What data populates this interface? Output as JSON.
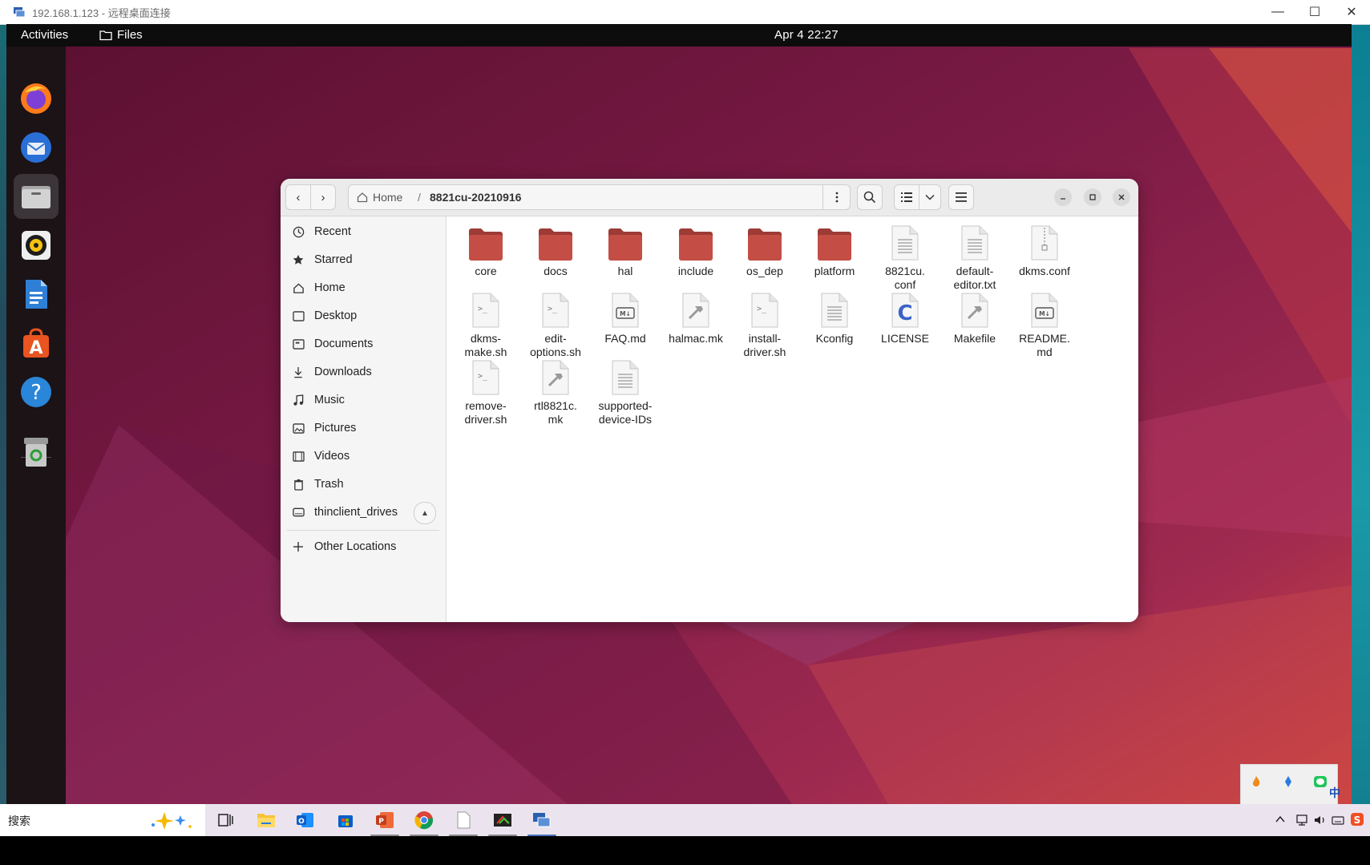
{
  "rdp": {
    "title": "192.168.1.123 - 远程桌面连接",
    "minimize": "—",
    "maximize": "☐",
    "close": "✕"
  },
  "topbar": {
    "activities": "Activities",
    "app_menu": "Files",
    "clock": "Apr 4  22:27"
  },
  "dock": {
    "items": [
      "firefox-icon",
      "thunderbird-icon",
      "files-icon",
      "rhythmbox-icon",
      "libreoffice-writer-icon",
      "app-center-icon",
      "help-icon",
      "trash-icon"
    ]
  },
  "nautilus": {
    "back": "‹",
    "forward": "›",
    "path": {
      "home": "Home",
      "separator": "/",
      "current": "8821cu-20210916"
    },
    "sidebar": [
      {
        "label": "Recent",
        "icon": "clock-icon"
      },
      {
        "label": "Starred",
        "icon": "star-icon"
      },
      {
        "label": "Home",
        "icon": "home-icon"
      },
      {
        "label": "Desktop",
        "icon": "desktop-icon"
      },
      {
        "label": "Documents",
        "icon": "documents-icon"
      },
      {
        "label": "Downloads",
        "icon": "download-icon"
      },
      {
        "label": "Music",
        "icon": "music-icon"
      },
      {
        "label": "Pictures",
        "icon": "pictures-icon"
      },
      {
        "label": "Videos",
        "icon": "videos-icon"
      },
      {
        "label": "Trash",
        "icon": "trash-icon"
      },
      {
        "label": "thinclient_drives",
        "icon": "drive-icon"
      },
      {
        "label": "Other Locations",
        "icon": "plus-icon"
      }
    ],
    "files": [
      {
        "name": "core",
        "kind": "folder"
      },
      {
        "name": "docs",
        "kind": "folder"
      },
      {
        "name": "hal",
        "kind": "folder"
      },
      {
        "name": "include",
        "kind": "folder"
      },
      {
        "name": "os_dep",
        "kind": "folder"
      },
      {
        "name": "platform",
        "kind": "folder"
      },
      {
        "name": "8821cu.\nconf",
        "kind": "text"
      },
      {
        "name": "default-\neditor.txt",
        "kind": "text"
      },
      {
        "name": "dkms.conf",
        "kind": "archive"
      },
      {
        "name": "dkms-\nmake.sh",
        "kind": "script"
      },
      {
        "name": "edit-\noptions.sh",
        "kind": "script"
      },
      {
        "name": "FAQ.md",
        "kind": "markdown"
      },
      {
        "name": "halmac.mk",
        "kind": "makefile"
      },
      {
        "name": "install-\ndriver.sh",
        "kind": "script"
      },
      {
        "name": "Kconfig",
        "kind": "text"
      },
      {
        "name": "LICENSE",
        "kind": "c"
      },
      {
        "name": "Makefile",
        "kind": "makefile"
      },
      {
        "name": "README.\nmd",
        "kind": "markdown"
      },
      {
        "name": "remove-\ndriver.sh",
        "kind": "script"
      },
      {
        "name": "rtl8821c.\nmk",
        "kind": "makefile"
      },
      {
        "name": "supported-\ndevice-IDs",
        "kind": "text"
      }
    ]
  },
  "taskbar": {
    "search_label": "搜索",
    "ime": "中",
    "apps": [
      "task-view-icon",
      "file-explorer-icon",
      "outlook-icon",
      "store-icon",
      "powerpoint-icon",
      "chrome-icon",
      "notepad-icon",
      "app-icon",
      "remote-desktop-icon"
    ]
  },
  "colors": {
    "folder": "#c44d40",
    "ubuntu_dark": "#1b1316",
    "accent": "#e95420"
  }
}
